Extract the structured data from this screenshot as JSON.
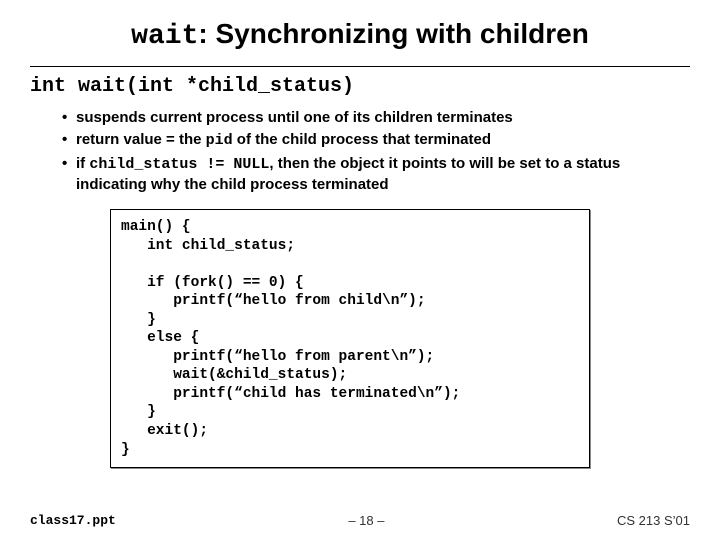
{
  "title": {
    "mono": "wait",
    "rest": ": Synchronizing with children"
  },
  "signature": "int wait(int *child_status)",
  "bullets": [
    {
      "pre": "suspends current process until one of its children terminates"
    },
    {
      "pre": "return value = the ",
      "mono": "pid",
      "post": " of the child process that terminated"
    },
    {
      "pre": "if ",
      "mono": "child_status != NULL",
      "post": ", then the object it points to will be set to a status indicating why the child process terminated"
    }
  ],
  "code": "main() {\n   int child_status;\n\n   if (fork() == 0) {\n      printf(“hello from child\\n”);\n   }\n   else {\n      printf(“hello from parent\\n”);\n      wait(&child_status);\n      printf(“child has terminated\\n”);\n   }\n   exit();\n}",
  "footer": {
    "left": "class17.ppt",
    "center": "– 18 –",
    "right": "CS 213 S’01"
  }
}
